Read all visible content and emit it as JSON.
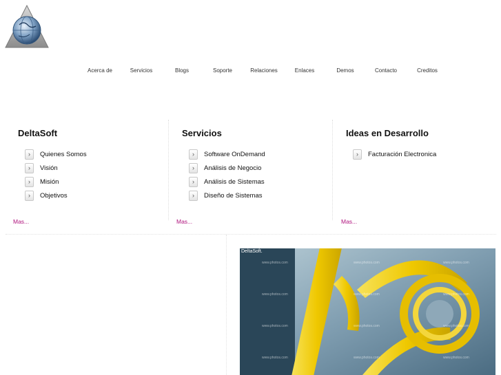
{
  "nav": {
    "items": [
      {
        "label": "Acerca de"
      },
      {
        "label": "Servicios"
      },
      {
        "label": "Blogs"
      },
      {
        "label": "Soporte"
      },
      {
        "label": "Relaciones"
      },
      {
        "label": "Enlaces"
      },
      {
        "label": "Demos"
      },
      {
        "label": "Contacto"
      },
      {
        "label": "Creditos"
      }
    ]
  },
  "columns": [
    {
      "title": "DeltaSoft",
      "items": [
        "Quienes Somos",
        "Visión",
        "Misión",
        "Objetivos"
      ],
      "more": "Mas..."
    },
    {
      "title": "Servicios",
      "items": [
        "Software OnDemand",
        "Análisis de Negocio",
        "Análisis de Sistemas",
        "Diseño de Sistemas"
      ],
      "more": "Mas..."
    },
    {
      "title": "Ideas en Desarrollo",
      "items": [
        "Facturación Electronica"
      ],
      "more": "Mas..."
    }
  ],
  "banner": {
    "caption": "DeltaSoft.",
    "watermark": "www.photos.com"
  },
  "icons": {
    "logo": "deltasoft-logo-icon",
    "bullet": "chevron-right-icon"
  },
  "colors": {
    "link_more": "#b0147e",
    "banner_dark": "#2a4658",
    "tape_yellow": "#f0d200"
  }
}
